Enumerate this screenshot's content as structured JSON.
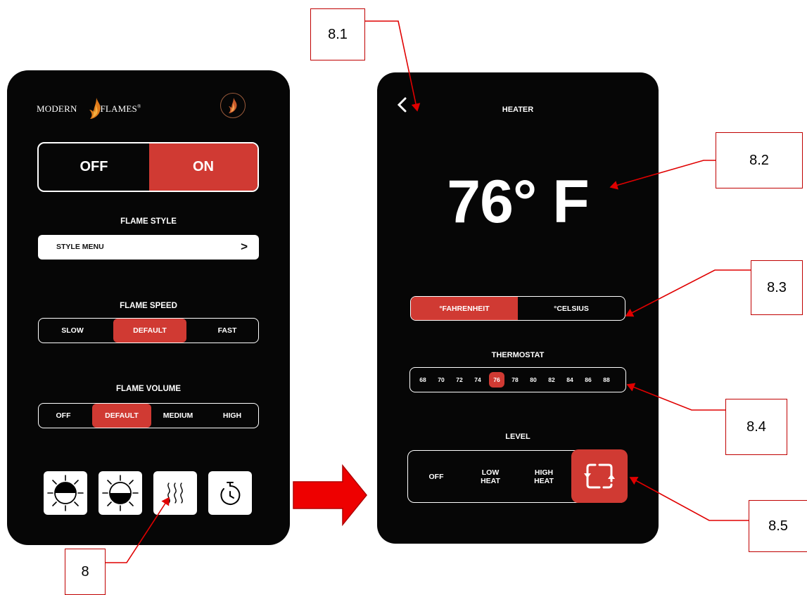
{
  "left_screen": {
    "brand_left": "MODERN",
    "brand_right": "FLAMES",
    "brand_mark": "®",
    "power": {
      "off_label": "OFF",
      "on_label": "ON"
    },
    "flame_style": {
      "title": "FLAME STYLE",
      "menu_label": "STYLE MENU",
      "arrow": ">"
    },
    "flame_speed": {
      "title": "FLAME SPEED",
      "options": [
        "SLOW",
        "DEFAULT",
        "FAST"
      ],
      "selected": "DEFAULT"
    },
    "flame_volume": {
      "title": "FLAME VOLUME",
      "options": [
        "OFF",
        "DEFAULT",
        "MEDIUM",
        "HIGH"
      ],
      "selected": "DEFAULT"
    },
    "bottom_icons": [
      "brightness-up-icon",
      "brightness-down-icon",
      "heater-icon",
      "timer-icon"
    ]
  },
  "right_screen": {
    "back_arrow": "<",
    "title": "HEATER",
    "temperature": "76° F",
    "units": {
      "fahrenheit": "°FAHRENHEIT",
      "celsius": "°CELSIUS",
      "selected": "fahrenheit"
    },
    "thermostat": {
      "title": "THERMOSTAT",
      "values": [
        "68",
        "70",
        "72",
        "74",
        "76",
        "78",
        "80",
        "82",
        "84",
        "86",
        "88"
      ],
      "selected": "76"
    },
    "level": {
      "title": "LEVEL",
      "off": "OFF",
      "low_line1": "LOW",
      "low_line2": "HEAT",
      "high_line1": "HIGH",
      "high_line2": "HEAT",
      "cycle_icon": "cycle-icon"
    }
  },
  "callouts": {
    "c8": "8",
    "c81": "8.1",
    "c82": "8.2",
    "c83": "8.3",
    "c84": "8.4",
    "c85": "8.5"
  },
  "colors": {
    "accent_red": "#d03a33",
    "screen_bg": "#060606",
    "annotation_red": "#e00000"
  }
}
